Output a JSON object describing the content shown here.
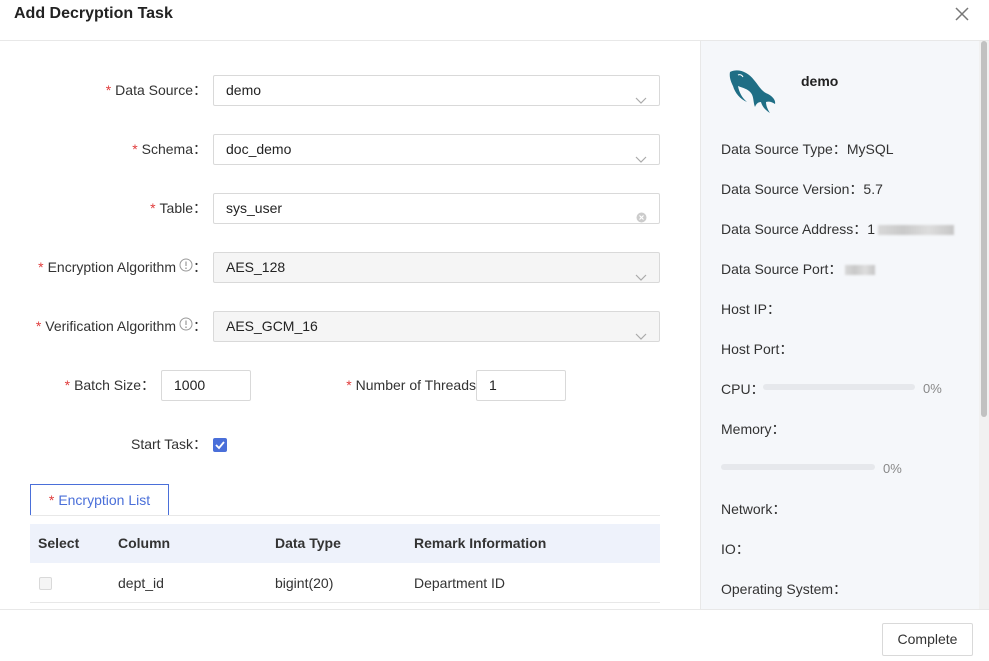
{
  "dialog": {
    "title": "Add Decryption Task"
  },
  "form": {
    "data_source": {
      "label": "Data Source",
      "value": "demo"
    },
    "schema": {
      "label": "Schema",
      "value": "doc_demo"
    },
    "table": {
      "label": "Table",
      "value": "sys_user"
    },
    "encryption_algorithm": {
      "label": "Encryption Algorithm",
      "value": "AES_128"
    },
    "verification_algorithm": {
      "label": "Verification Algorithm",
      "value": "AES_GCM_16"
    },
    "batch_size": {
      "label": "Batch Size",
      "value": "1000"
    },
    "threads": {
      "label": "Number of Threads",
      "value": "1"
    },
    "start_task": {
      "label": "Start Task",
      "checked": true
    },
    "colon": "："
  },
  "encryption_list": {
    "tab_label": "Encryption List",
    "headers": [
      "Select",
      "Column",
      "Data Type",
      "Remark Information"
    ],
    "rows": [
      {
        "column": "dept_id",
        "data_type": "bigint(20)",
        "remark": "Department ID"
      }
    ]
  },
  "side_panel": {
    "name": "demo",
    "rows": [
      {
        "label": "Data Source Type：",
        "value": "MySQL"
      },
      {
        "label": "Data Source Version：",
        "value": "5.7"
      },
      {
        "label": "Data Source Address：",
        "value": "1"
      },
      {
        "label": "Data Source Port：",
        "value": ""
      },
      {
        "label": "Host IP：",
        "value": ""
      },
      {
        "label": "Host Port：",
        "value": ""
      }
    ],
    "cpu": {
      "label": "CPU：",
      "percent": "0%",
      "fraction": 0
    },
    "memory": {
      "label": "Memory：",
      "percent": "0%",
      "fraction": 0
    },
    "network": {
      "label": "Network："
    },
    "io": {
      "label": "IO："
    },
    "os": {
      "label": "Operating System："
    }
  },
  "footer": {
    "complete_label": "Complete"
  },
  "colors": {
    "accent": "#4a6fd9",
    "required": "#e03c3c"
  },
  "icons": [
    "close-icon",
    "chevron-down-icon",
    "clear-icon",
    "info-icon",
    "check-icon",
    "mysql-dolphin-icon"
  ]
}
